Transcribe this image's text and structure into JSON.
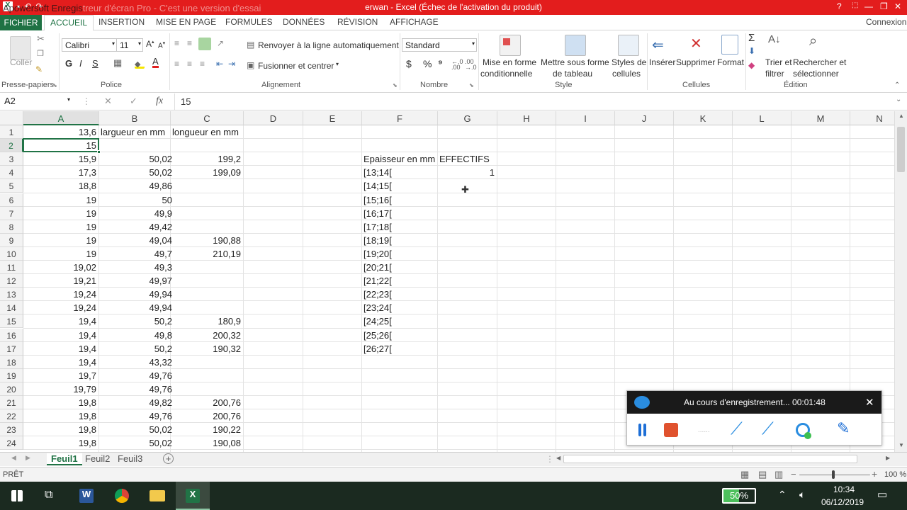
{
  "titlebar": {
    "title": "erwan -  Excel (Échec de l'activation du produit)",
    "watermark": "Apowersoft Enregis",
    "watermark_tail": "treur d'écran Pro - C'est une version d'essai",
    "help": "?",
    "min": "—",
    "restore": "❐",
    "close": "✕"
  },
  "tabs": {
    "file": "FICHIER",
    "items": [
      "ACCUEIL",
      "INSERTION",
      "MISE EN PAGE",
      "FORMULES",
      "DONNÉES",
      "RÉVISION",
      "AFFICHAGE"
    ],
    "signin": "Connexion"
  },
  "ribbon": {
    "paste": "Coller",
    "clipboard_group": "Presse-papiers",
    "font_name": "Calibri",
    "font_size": "11",
    "bold": "G",
    "italic": "I",
    "underline": "S",
    "font_group": "Police",
    "wrap_text": "Renvoyer à la ligne automatiquement",
    "merge_center": "Fusionner et centrer",
    "align_group": "Alignement",
    "number_format": "Standard",
    "currency": "$",
    "percent": "%",
    "thousands": "⁹",
    "number_group": "Nombre",
    "cond_format_1": "Mise en forme",
    "cond_format_2": "conditionnelle",
    "table_format_1": "Mettre sous forme",
    "table_format_2": "de tableau",
    "cell_styles_1": "Styles de",
    "cell_styles_2": "cellules",
    "style_group": "Style",
    "insert": "Insérer",
    "delete": "Supprimer",
    "format": "Format",
    "cells_group": "Cellules",
    "sort_1": "Trier et",
    "sort_2": "filtrer",
    "find_1": "Rechercher et",
    "find_2": "sélectionner",
    "edit_group": "Édition"
  },
  "formula_bar": {
    "name_box": "A2",
    "cancel": "✕",
    "enter": "✓",
    "fx": "fx",
    "value": "15"
  },
  "columns": [
    "A",
    "B",
    "C",
    "D",
    "E",
    "F",
    "G",
    "H",
    "I",
    "J",
    "K",
    "L",
    "M",
    "N"
  ],
  "rows": [
    {
      "n": "1",
      "A": "13,6",
      "B": "largueur en mm",
      "C": "longueur en mm",
      "F": "",
      "G": ""
    },
    {
      "n": "2",
      "A": "15",
      "B": "",
      "C": "",
      "F": "",
      "G": ""
    },
    {
      "n": "3",
      "A": "15,9",
      "B": "50,02",
      "C": "199,2",
      "F": "Epaisseur en mm",
      "G": "EFFECTIFS"
    },
    {
      "n": "4",
      "A": "17,3",
      "B": "50,02",
      "C": "199,09",
      "F": "[13;14[",
      "G": "1"
    },
    {
      "n": "5",
      "A": "18,8",
      "B": "49,86",
      "C": "",
      "F": "[14;15[",
      "G": ""
    },
    {
      "n": "6",
      "A": "19",
      "B": "50",
      "C": "",
      "F": "[15;16[",
      "G": ""
    },
    {
      "n": "7",
      "A": "19",
      "B": "49,9",
      "C": "",
      "F": "[16;17[",
      "G": ""
    },
    {
      "n": "8",
      "A": "19",
      "B": "49,42",
      "C": "",
      "F": "[17;18[",
      "G": ""
    },
    {
      "n": "9",
      "A": "19",
      "B": "49,04",
      "C": "190,88",
      "F": "[18;19[",
      "G": ""
    },
    {
      "n": "10",
      "A": "19",
      "B": "49,7",
      "C": "210,19",
      "F": "[19;20[",
      "G": ""
    },
    {
      "n": "11",
      "A": "19,02",
      "B": "49,3",
      "C": "",
      "F": "[20;21[",
      "G": ""
    },
    {
      "n": "12",
      "A": "19,21",
      "B": "49,97",
      "C": "",
      "F": "[21;22[",
      "G": ""
    },
    {
      "n": "13",
      "A": "19,24",
      "B": "49,94",
      "C": "",
      "F": "[22;23[",
      "G": ""
    },
    {
      "n": "14",
      "A": "19,24",
      "B": "49,94",
      "C": "",
      "F": "[23;24[",
      "G": ""
    },
    {
      "n": "15",
      "A": "19,4",
      "B": "50,2",
      "C": "180,9",
      "F": "[24;25[",
      "G": ""
    },
    {
      "n": "16",
      "A": "19,4",
      "B": "49,8",
      "C": "200,32",
      "F": "[25;26[",
      "G": ""
    },
    {
      "n": "17",
      "A": "19,4",
      "B": "50,2",
      "C": "190,32",
      "F": "[26;27[",
      "G": ""
    },
    {
      "n": "18",
      "A": "19,4",
      "B": "43,32",
      "C": "",
      "F": "",
      "G": ""
    },
    {
      "n": "19",
      "A": "19,7",
      "B": "49,76",
      "C": "",
      "F": "",
      "G": ""
    },
    {
      "n": "20",
      "A": "19,79",
      "B": "49,76",
      "C": "",
      "F": "",
      "G": ""
    },
    {
      "n": "21",
      "A": "19,8",
      "B": "49,82",
      "C": "200,76",
      "F": "",
      "G": ""
    },
    {
      "n": "22",
      "A": "19,8",
      "B": "49,76",
      "C": "200,76",
      "F": "",
      "G": ""
    },
    {
      "n": "23",
      "A": "19,8",
      "B": "50,02",
      "C": "190,22",
      "F": "",
      "G": ""
    },
    {
      "n": "24",
      "A": "19,8",
      "B": "50,02",
      "C": "190,08",
      "F": "",
      "G": ""
    }
  ],
  "sheets": [
    "Feuil1",
    "Feuil2",
    "Feuil3"
  ],
  "add_sheet": "+",
  "status": {
    "mode": "PRÊT",
    "zoom_minus": "−",
    "zoom_plus": "+",
    "zoom": "100 %"
  },
  "recorder": {
    "text": "Au cours d'enregistrement... 00:01:48",
    "close": "✕"
  },
  "taskbar": {
    "battery": "50%",
    "time": "10:34",
    "date": "06/12/2019"
  },
  "colors": {
    "excel_green": "#217346",
    "title_red": "#e31d1d"
  }
}
